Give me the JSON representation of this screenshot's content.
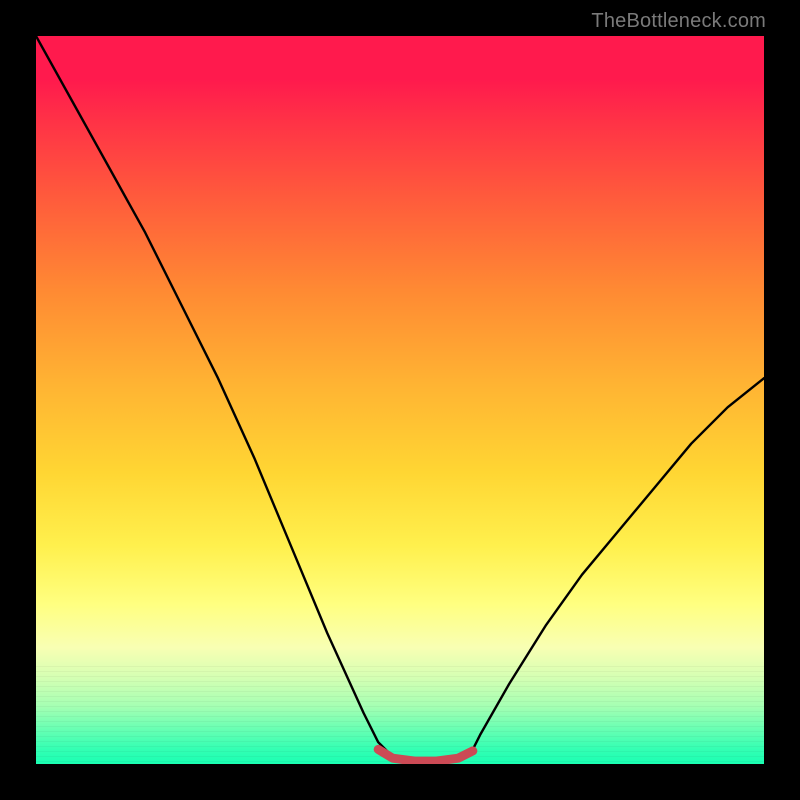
{
  "watermark": "TheBottleneck.com",
  "chart_data": {
    "type": "line",
    "title": "",
    "xlabel": "",
    "ylabel": "",
    "xlim": [
      0,
      100
    ],
    "ylim": [
      0,
      100
    ],
    "grid": false,
    "series": [
      {
        "name": "black-curve",
        "color": "#000000",
        "x": [
          0,
          5,
          10,
          15,
          20,
          25,
          30,
          35,
          40,
          45,
          47,
          49,
          52,
          55,
          58,
          60,
          61,
          65,
          70,
          75,
          80,
          85,
          90,
          95,
          100
        ],
        "values": [
          100,
          91,
          82,
          73,
          63,
          53,
          42,
          30,
          18,
          7,
          3,
          1,
          0.3,
          0.3,
          1,
          2,
          4,
          11,
          19,
          26,
          32,
          38,
          44,
          49,
          53
        ]
      },
      {
        "name": "red-baseline",
        "color": "#cc4a55",
        "x": [
          47,
          49,
          52,
          55,
          58,
          60
        ],
        "values": [
          2,
          0.8,
          0.4,
          0.4,
          0.8,
          1.8
        ]
      }
    ],
    "annotations": []
  }
}
